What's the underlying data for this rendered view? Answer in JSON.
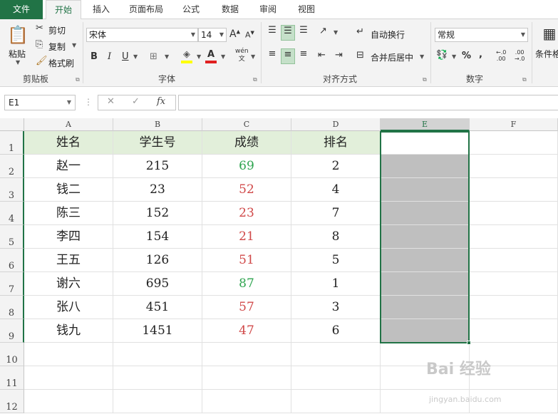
{
  "tabs": [
    "文件",
    "开始",
    "插入",
    "页面布局",
    "公式",
    "数据",
    "审阅",
    "视图"
  ],
  "clipboard": {
    "paste": "粘贴",
    "cut": "剪切",
    "copy": "复制",
    "format_painter": "格式刷",
    "label": "剪贴板"
  },
  "font": {
    "name": "宋体",
    "size": "14",
    "bold": "B",
    "italic": "I",
    "underline": "U",
    "label": "字体",
    "grow": "A",
    "shrink": "A",
    "wen": "wén",
    "wen2": "文",
    "fontcolor": "A"
  },
  "alignment": {
    "wrap": "自动换行",
    "merge": "合并后居中",
    "label": "对齐方式"
  },
  "number": {
    "format": "常规",
    "percent": "%",
    "comma": ",",
    "label": "数字",
    "inc": "←.0\n.00",
    "dec": ".00\n→.0"
  },
  "styles": {
    "conditional": "条件格"
  },
  "formula_bar": {
    "name_box": "E1",
    "fx": "fx",
    "cancel": "✕",
    "enter": "✓",
    "value": ""
  },
  "columns": [
    "A",
    "B",
    "C",
    "D",
    "E",
    "F"
  ],
  "rows": [
    "1",
    "2",
    "3",
    "4",
    "5",
    "6",
    "7",
    "8",
    "9",
    "10",
    "11",
    "12"
  ],
  "table": {
    "headers": [
      "姓名",
      "学生号",
      "成绩",
      "排名"
    ],
    "data": [
      [
        "赵一",
        "215",
        "69",
        "2"
      ],
      [
        "钱二",
        "23",
        "52",
        "4"
      ],
      [
        "陈三",
        "152",
        "23",
        "7"
      ],
      [
        "李四",
        "154",
        "21",
        "8"
      ],
      [
        "王五",
        "126",
        "51",
        "5"
      ],
      [
        "谢六",
        "695",
        "87",
        "1"
      ],
      [
        "张八",
        "451",
        "57",
        "3"
      ],
      [
        "钱九",
        "1451",
        "47",
        "6"
      ]
    ],
    "score_colors": [
      "#2ea44f",
      "#d04848",
      "#d04848",
      "#d04848",
      "#d04848",
      "#2ea44f",
      "#d04848",
      "#d04848"
    ]
  },
  "watermark": {
    "main": "Bai  经验",
    "sub": "jingyan.baidu.com"
  },
  "colors": {
    "excel_green": "#217346",
    "header_fill": "#e2efda",
    "selection_fill": "#bfbfbf"
  }
}
